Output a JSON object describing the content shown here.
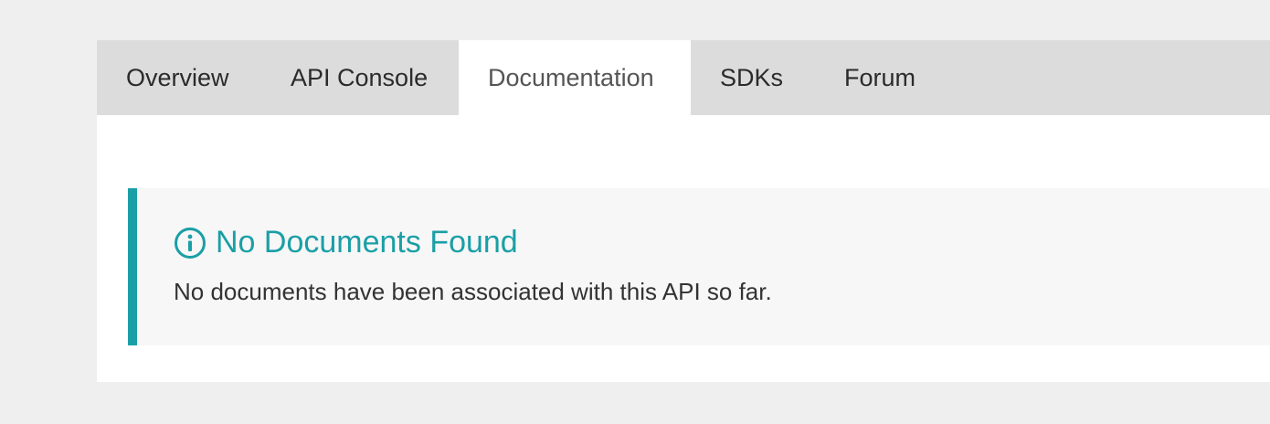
{
  "tabs": [
    {
      "label": "Overview"
    },
    {
      "label": "API Console"
    },
    {
      "label": "Documentation"
    },
    {
      "label": "SDKs"
    },
    {
      "label": "Forum"
    }
  ],
  "active_tab": "Documentation",
  "notice": {
    "icon": "info-icon",
    "title": "No Documents Found",
    "message": "No documents have been associated with this API so far."
  },
  "colors": {
    "accent": "#1a9fa6",
    "page_background": "#efefef",
    "tabbar_background": "#dcdcdc",
    "notice_background": "#f7f7f7"
  }
}
